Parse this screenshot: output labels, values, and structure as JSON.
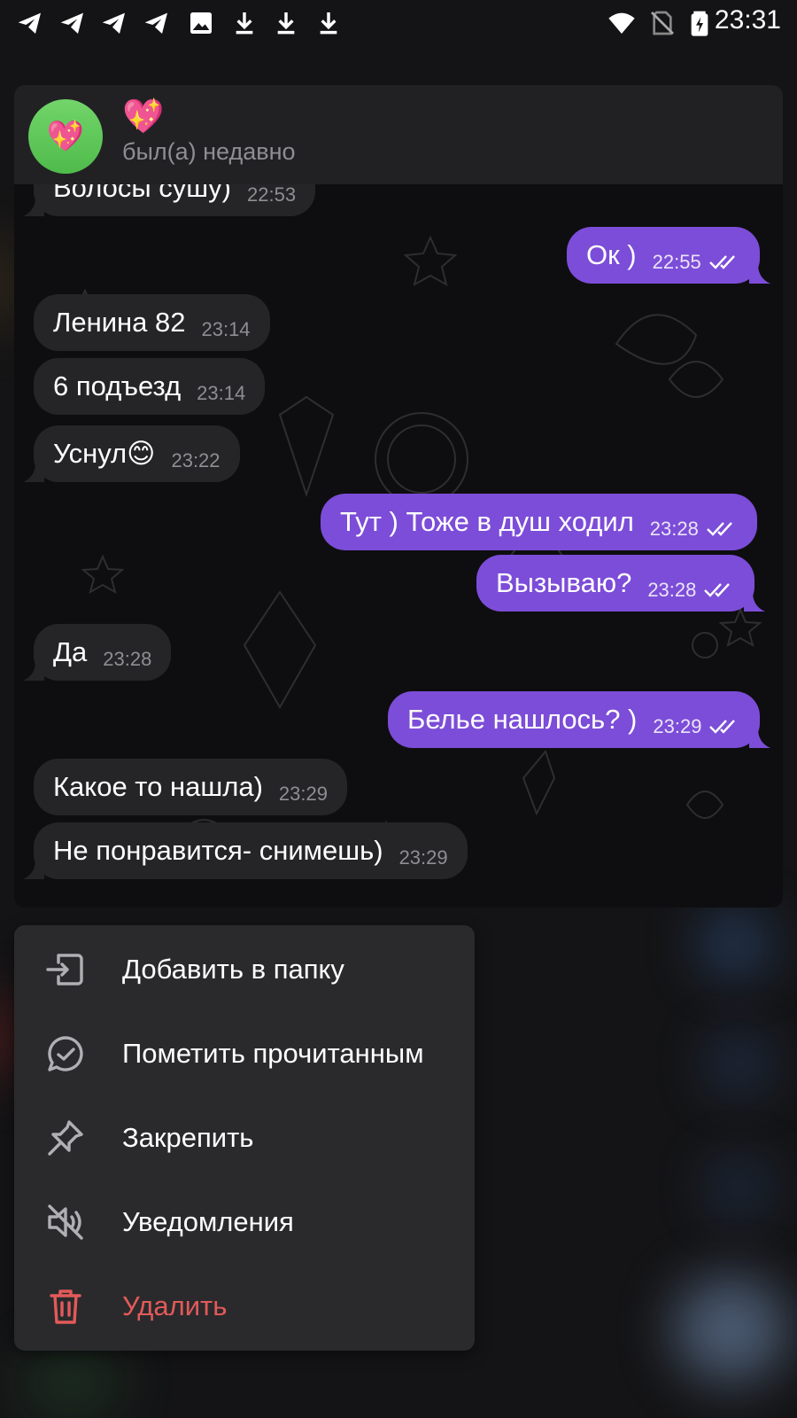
{
  "status_bar": {
    "time": "23:31",
    "left_icons": [
      "telegram-icon",
      "telegram-icon",
      "telegram-icon",
      "telegram-icon",
      "image-icon",
      "download-icon",
      "download-icon",
      "download-icon"
    ],
    "right_icons": [
      "wifi-icon",
      "no-sim-icon",
      "battery-charging-icon"
    ]
  },
  "chat": {
    "name": "💖",
    "avatar_emoji": "💖",
    "status": "был(а) недавно",
    "messages": [
      {
        "dir": "in",
        "text": "Волосы сушу)",
        "time": "22:53"
      },
      {
        "dir": "out",
        "text": "Ок )",
        "time": "22:55",
        "read": true
      },
      {
        "dir": "in",
        "text": "Ленина 82",
        "time": "23:14"
      },
      {
        "dir": "in",
        "text": "6 подъезд",
        "time": "23:14"
      },
      {
        "dir": "in",
        "text": "Уснул😊",
        "time": "23:22"
      },
      {
        "dir": "out",
        "text": "Тут ) Тоже в душ ходил",
        "time": "23:28",
        "read": true
      },
      {
        "dir": "out",
        "text": "Вызываю?",
        "time": "23:28",
        "read": true
      },
      {
        "dir": "in",
        "text": "Да",
        "time": "23:28"
      },
      {
        "dir": "out",
        "text": "Белье нашлось? )",
        "time": "23:29",
        "read": true
      },
      {
        "dir": "in",
        "text": "Какое то нашла)",
        "time": "23:29"
      },
      {
        "dir": "in",
        "text": "Не понравится- снимешь)",
        "time": "23:29"
      }
    ]
  },
  "menu": {
    "items": [
      {
        "label": "Добавить в папку",
        "icon": "folder-add-icon"
      },
      {
        "label": "Пометить прочитанным",
        "icon": "mark-read-icon"
      },
      {
        "label": "Закрепить",
        "icon": "pin-icon"
      },
      {
        "label": "Уведомления",
        "icon": "mute-icon"
      },
      {
        "label": "Удалить",
        "icon": "trash-icon",
        "danger": true
      }
    ]
  },
  "colors": {
    "outgoing_bubble": "#7c4dd8",
    "incoming_bubble": "#252527",
    "danger": "#e35a5a",
    "avatar": "#5fc85a"
  }
}
